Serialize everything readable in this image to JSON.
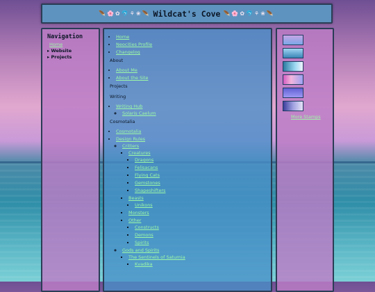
{
  "header": {
    "title": "Wildcat's Cove",
    "decoration_left": "🪶🌸✿🐬⚘❀🪶",
    "decoration_right": "🪶🌸✿🐬⚘❀🪶"
  },
  "nav": {
    "title": "Navigation",
    "home": "Home",
    "folders": [
      "▸ Website",
      "▸ Projects"
    ]
  },
  "main": {
    "top_links": [
      "Home",
      "Neocities Profile",
      "Changelog"
    ],
    "about_title": "About",
    "about_links": [
      "About Me",
      "About the Site"
    ],
    "projects_title": "Projects",
    "writing_title": "Writing",
    "writing_hub": "Writing Hub",
    "writing_sub": "Solaris Caelum",
    "cosmotalia_title": "Cosmotalia",
    "cosmotalia": "Cosmotalia",
    "design_rules": "Design Rules",
    "critters": "Critters",
    "creatures": "Creatures",
    "creature_list": [
      "Dragons",
      "Felisacans",
      "Flying Cats",
      "Gemstones",
      "Shapeshifters"
    ],
    "beasts": "Beasts",
    "beast_list": [
      "Unikons"
    ],
    "monsters": "Monsters",
    "other": "Other",
    "other_list": [
      "Constructs",
      "Demons",
      "Spirits"
    ],
    "gods": "Gods and Spirits",
    "sentinels": "The Sentinels of Saturnia",
    "sentinel_child": "Kvadika"
  },
  "side": {
    "thumbnails": [
      "thumb-1",
      "thumb-2",
      "thumb-3",
      "thumb-4",
      "thumb-5",
      "thumb-6"
    ],
    "more_label": "More Stamps"
  }
}
